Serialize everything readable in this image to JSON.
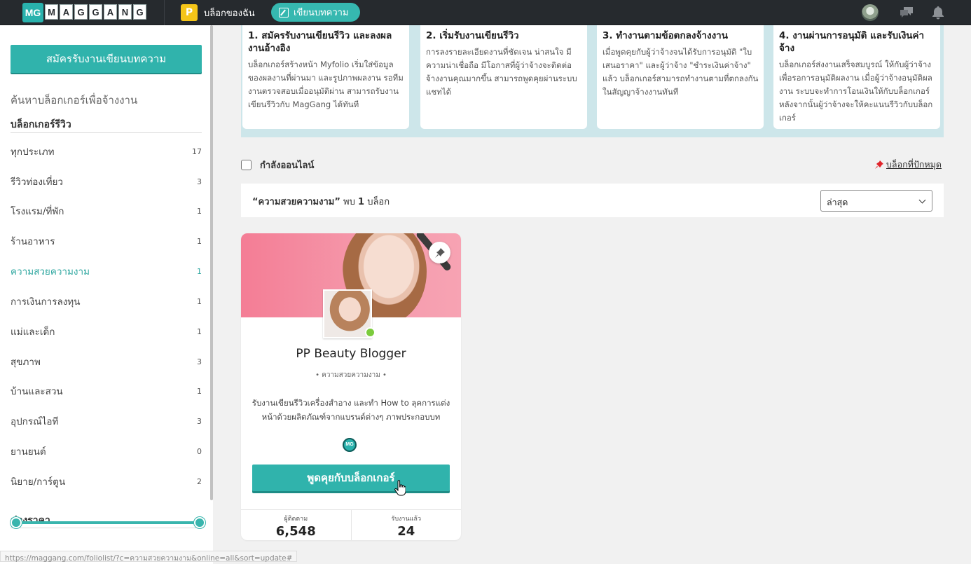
{
  "topbar": {
    "logo_mark": "MG",
    "logo_letters": [
      "M",
      "A",
      "G",
      "G",
      "A",
      "N",
      "G"
    ],
    "my_blog_initial": "P",
    "my_blog_label": "บล็อกของฉัน",
    "write_label": "เขียนบทความ"
  },
  "sidebar": {
    "apply_button": "สมัครรับงานเขียนบทความ",
    "find_label": "ค้นหาบล็อกเกอร์เพื่อจ้างงาน",
    "reviewers_title": "บล็อกเกอร์รีวิว",
    "categories": [
      {
        "name": "ทุกประเภท",
        "count": "17"
      },
      {
        "name": "รีวิวท่องเที่ยว",
        "count": "3"
      },
      {
        "name": "โรงแรม/ที่พัก",
        "count": "1"
      },
      {
        "name": "ร้านอาหาร",
        "count": "1"
      },
      {
        "name": "ความสวยความงาม",
        "count": "1"
      },
      {
        "name": "การเงินการลงทุน",
        "count": "1"
      },
      {
        "name": "แม่และเด็ก",
        "count": "1"
      },
      {
        "name": "สุขภาพ",
        "count": "3"
      },
      {
        "name": "บ้านและสวน",
        "count": "1"
      },
      {
        "name": "อุปกรณ์ไอที",
        "count": "3"
      },
      {
        "name": "ยานยนต์",
        "count": "0"
      },
      {
        "name": "นิยาย/การ์ตูน",
        "count": "2"
      }
    ],
    "price_title": "ช่วงราคา"
  },
  "steps": [
    {
      "title": "1. สมัครรับงานเขียนรีวิว และลงผลงานอ้างอิง",
      "text": "บล็อกเกอร์สร้างหน้า Myfolio เริ่มใส่ข้อมูลของผลงานที่ผ่านมา และรูปภาพผลงาน รอทีมงานตรวจสอบเมื่ออนุมัติผ่าน สามารถรับงานเขียนรีวิวกับ MagGang ได้ทันที"
    },
    {
      "title": "2. เริ่มรับงานเขียนรีวิว",
      "text": "การลงรายละเอียดงานที่ชัดเจน น่าสนใจ มีความน่าเชื่อถือ มีโอกาสที่ผู้ว่าจ้างจะติดต่อจ้างงานคุณมากขึ้น สามารถพูดคุยผ่านระบบแชทได้"
    },
    {
      "title": "3. ทำงานตามข้อตกลงจ้างงาน",
      "text": "เมื่อพูดคุยกับผู้ว่าจ้างจนได้รับการอนุมัติ \"ใบเสนอราคา\" และผู้ว่าจ้าง \"ชำระเงินค่าจ้าง\" แล้ว บล็อกเกอร์สามารถทำงานตามที่ตกลงกันในสัญญาจ้างงานทันที"
    },
    {
      "title": "4. งานผ่านการอนุมัติ และรับเงินค่าจ้าง",
      "text": "บล็อกเกอร์ส่งงานเสร็จสมบูรณ์ ให้กับผู้ว่าจ้างเพื่อรอการอนุมัติผลงาน เมื่อผู้ว่าจ้างอนุมัติผลงาน ระบบจะทำการโอนเงินให้กับบล็อกเกอร์ หลังจากนั้นผู้ว่าจ้างจะให้คะแนนรีวิวกับบล็อกเกอร์"
    }
  ],
  "filters": {
    "online_label": "กำลังออนไลน์",
    "pinned_label": "บล็อกที่ปักหมุด"
  },
  "results": {
    "query": "“ความสวยความงาม”",
    "found_prefix": "พบ",
    "count": "1",
    "unit": "บล็อก",
    "sort_value": "ล่าสุด"
  },
  "card": {
    "name": "PP Beauty Blogger",
    "category": "• ความสวยความงาม •",
    "description": "รับงานเขียนรีวิวเครื่องสำอาง และทำ How to ลุคการแต่งหน้าด้วยผลิตภัณฑ์จากแบรนด์ต่างๆ ภาพประกอบบท",
    "badge": "MG",
    "chat_button": "พูดคุยกับบล็อกเกอร์",
    "followers_label": "ผู้ติดตาม",
    "followers_value": "6,548",
    "jobs_label": "รับงานแล้ว",
    "jobs_value": "24"
  },
  "status_url": "https://maggang.com/foliolist/?c=ความสวยความงาม&online=all&sort=update#",
  "colors": {
    "accent": "#30b3ac",
    "topbar": "#262a2e",
    "steps_bg": "#cde6ea",
    "online": "#7ccb3d"
  }
}
